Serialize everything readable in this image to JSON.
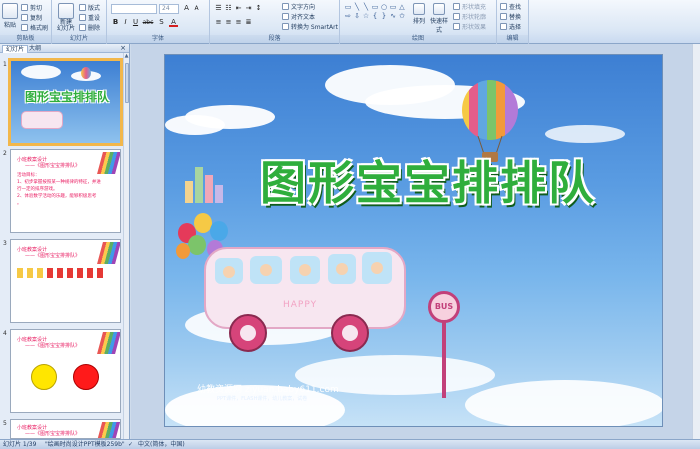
{
  "ribbon": {
    "clipboard": {
      "label": "剪贴板",
      "paste": "粘贴",
      "cut": "剪切",
      "copy": "复制",
      "format_painter": "格式刷"
    },
    "slides": {
      "label": "幻灯片",
      "new_slide": "新建\n幻灯片",
      "layout": "版式",
      "reset": "重设",
      "delete": "删除"
    },
    "font": {
      "label": "字体",
      "font_name": "",
      "font_size": "24",
      "bold": "B",
      "italic": "I",
      "underline": "U",
      "strike": "abc",
      "shadow": "S"
    },
    "paragraph": {
      "label": "段落",
      "text_direction": "文字方向",
      "align_text": "对齐文本",
      "convert_smartart": "转换为 SmartArt"
    },
    "drawing": {
      "label": "绘图",
      "arrange": "排列",
      "quick_styles": "快速样式",
      "shape_fill": "形状填充",
      "shape_outline": "形状轮廓",
      "shape_effects": "形状效果"
    },
    "editing": {
      "label": "编辑",
      "find": "查找",
      "replace": "替换",
      "select": "选择"
    }
  },
  "left_pane": {
    "tab_slides": "幻灯片",
    "tab_outline": "大纲",
    "close": "×",
    "slides": [
      {
        "num": "1",
        "title": "图形宝宝排排队"
      },
      {
        "num": "2",
        "heading": "小班教案设计",
        "subheading": "——《图形宝宝排排队》",
        "lines": [
          "活动目标：",
          "1、初步掌握按照某一种规律的特征，并进",
          "行一定的排序游戏。",
          "2、体验数学活动的乐趣，能够积极思考",
          "。"
        ]
      },
      {
        "num": "3",
        "heading": "小班教案设计",
        "subheading": "——《图形宝宝排排队》"
      },
      {
        "num": "4",
        "heading": "小班教案设计",
        "subheading": "——《图形宝宝排排队》"
      },
      {
        "num": "5",
        "heading": "小班教案设计",
        "subheading": "——《图形宝宝排排队》"
      }
    ]
  },
  "slide": {
    "title": "图形宝宝排排队",
    "bus_text": "HAPPY",
    "sign_text": "BUS",
    "watermark": "幼教资源网 ziyuan.baby611.com",
    "watermark_sub": "PPT课件，FLASH课件，幼儿教案，试卷"
  },
  "status": {
    "slide_count": "幻灯片 1/39",
    "theme": "\"绘画时尚设计PPT模板259b\"",
    "language": "中文(简体，中国)"
  },
  "colors": {
    "title_green": "#2fae3c",
    "selected_outline": "#f2b74b",
    "ribbon_bg": "#dbe7f5"
  }
}
